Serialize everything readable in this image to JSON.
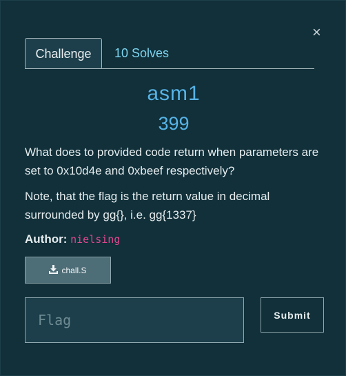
{
  "modal": {
    "close_label": "×",
    "tabs": [
      {
        "label": "Challenge"
      },
      {
        "label": "10 Solves"
      }
    ],
    "challenge": {
      "name": "asm1",
      "value": "399",
      "description_1": "What does to provided code return when parameters are set to 0x10d4e and 0xbeef respectively?",
      "description_2": "Note, that the flag is the return value in decimal surrounded by gg{}, i.e. gg{1337}",
      "author_label": "Author:",
      "author_name": "nielsing",
      "file_name": "chall.S"
    },
    "flag_placeholder": "Flag",
    "submit_label": "Submit"
  }
}
